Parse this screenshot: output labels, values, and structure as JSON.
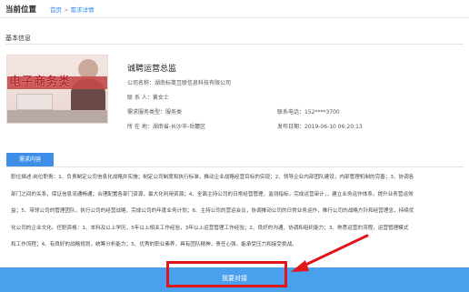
{
  "breadcrumb": {
    "label": "当前位置",
    "home": "首页",
    "sep": ">",
    "current": "需求详情"
  },
  "section": {
    "title": "基本信息"
  },
  "thumbnail": {
    "text": "电子商务类"
  },
  "detail": {
    "title": "诚聘运营总监",
    "company": "公司名称：湖南标笺互联信息科技有限公司",
    "contact": "联 系 人：黄女士",
    "service_type": "需求服务类型：服务类",
    "location": "所 在 地：湖南省-长沙市-岳麓区",
    "phone": "联系电话：152****3700",
    "publish_date": "发布日期：2019-06-10 06:20:13"
  },
  "tab": {
    "label": "需求内容"
  },
  "description": [
    "职位描述:岗位职责：1、负责制定公司信息化战略并实施；制定公司制度和执行标准，推动企业战略经营目标的实现；2、领导企业内部团队建设，内部管理机制的完善；3、协调各",
    "部门之间的关系，保证信息流通畅通；合理配置各部门资源，最大化利用资源；4、全面主持公司的日常经营管理，监测指标，完成运营审计，，建立业务运作体系，提升业务营运效",
    "益；5、带领公司的管理团队，执行公司的经营战略，完成公司的年度业务计划；6、主持公司的营运会议，协调推动公司的日常业务运作，推行公司的战略方针和经营理念，持续优",
    "化公司的企业文化。任职资格：1、本科及以上学历，5年以上相关工作经验，3年以上运营管理工作经验；2、良好的沟通、协调和组织能力；3、熟悉运营的流程，运营管理模式",
    "和工作流程；4、有良好的战略规划，统筹分析能力；5、优秀的职业素养，具有团队精神，责任心强，能承受压力和接受挑战。"
  ],
  "action": {
    "label": "我要对接"
  },
  "colors": {
    "accent": "#3e8ee8",
    "footer": "#4aa0ec",
    "highlight": "#e0161a"
  }
}
